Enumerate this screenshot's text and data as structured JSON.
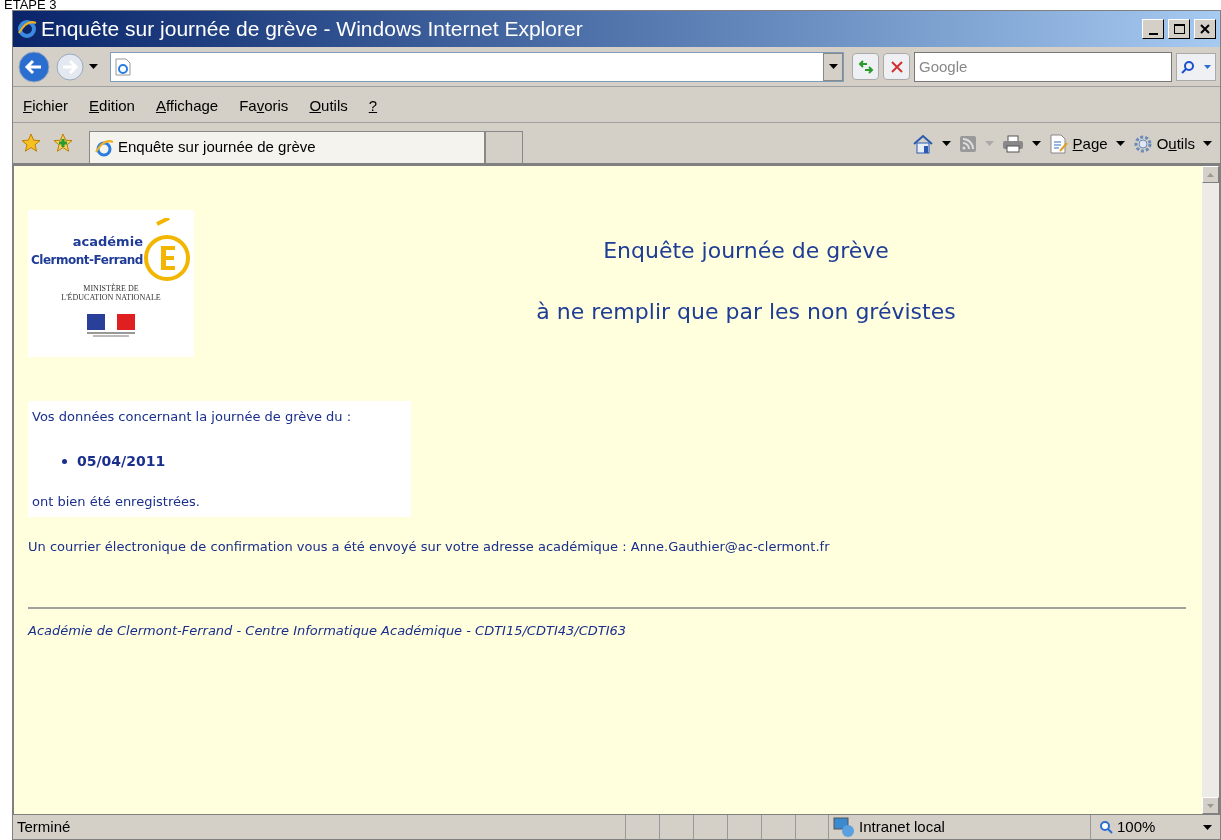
{
  "caption": "ETAPE 3",
  "window": {
    "title": "Enquête sur journée de grève - Windows Internet Explorer"
  },
  "search": {
    "placeholder": "Google"
  },
  "menu": [
    {
      "label": "Fichier"
    },
    {
      "label": "Edition"
    },
    {
      "label": "Affichage"
    },
    {
      "label": "Favoris"
    },
    {
      "label": "Outils"
    },
    {
      "label": "?"
    }
  ],
  "tabs": [
    {
      "label": "Enquête sur journée de grève",
      "selected": true
    }
  ],
  "command_bar": [
    {
      "kind": "home"
    },
    {
      "kind": "feeds",
      "disabled": true
    },
    {
      "kind": "print"
    },
    {
      "kind": "page",
      "label": "Page"
    },
    {
      "kind": "tools",
      "label": "Outils"
    }
  ],
  "page": {
    "logo": {
      "line1": "académie",
      "line2": "Clermont-Ferrand",
      "ministry": [
        "MINISTÈRE DE",
        "L'ÉDUCATION NATIONALE"
      ]
    },
    "headings": [
      "Enquête journée de grève",
      "à ne remplir que par les non grévistes"
    ],
    "notice": {
      "intro": "Vos données concernant la journée de grève du :",
      "dates": [
        "05/04/2011"
      ],
      "outro": "ont bien été enregistrées."
    },
    "confirmation": "Un courrier électronique de confirmation vous a été envoyé sur votre adresse académique : Anne.Gauthier@ac-clermont.fr",
    "footer": "Académie de Clermont-Ferrand - Centre Informatique Académique - CDTI15/CDTI43/CDTI63"
  },
  "status_bar": {
    "text": "Terminé",
    "zone": "Intranet local",
    "zoom": "100%"
  }
}
